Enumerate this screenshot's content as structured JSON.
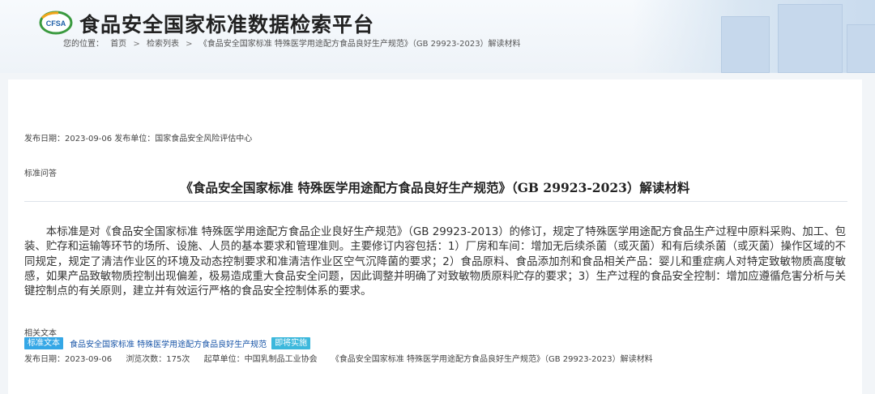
{
  "site": {
    "logo_text": "CFSA",
    "title": "食品安全国家标准数据检索平台"
  },
  "breadcrumb": {
    "prefix": "您的位置：",
    "home": "首页",
    "sep": ">",
    "list": "检索列表",
    "current": "《食品安全国家标准 特殊医学用途配方食品良好生产规范》（GB 29923-2023）解读材料"
  },
  "article": {
    "publish_meta": "发布日期：2023-09-06 发布单位：国家食品安全风险评估中心",
    "category": "标准问答",
    "title": "《食品安全国家标准 特殊医学用途配方食品良好生产规范》（GB 29923-2023）解读材料",
    "body": "本标准是对《食品安全国家标准 特殊医学用途配方食品企业良好生产规范》（GB 29923-2013）的修订，规定了特殊医学用途配方食品生产过程中原料采购、加工、包装、贮存和运输等环节的场所、设施、人员的基本要求和管理准则。主要修订内容包括：1）厂房和车间：增加无后续杀菌（或灭菌）和有后续杀菌（或灭菌）操作区域的不同规定，规定了清洁作业区的环境及动态控制要求和准清洁作业区空气沉降菌的要求；2）食品原料、食品添加剂和食品相关产品：婴儿和重症病人对特定致敏物质高度敏感，如果产品致敏物质控制出现偏差，极易造成重大食品安全问题，因此调整并明确了对致敏物质原料贮存的要求；3）生产过程的食品安全控制：增加应遵循危害分析与关键控制点的有关原则，建立并有效运行严格的食品安全控制体系的要求。"
  },
  "related": {
    "label": "相关文本",
    "tag_label": "标准文本",
    "std_name": "食品安全国家标准 特殊医学用途配方食品良好生产规范",
    "status": "即将实施",
    "publish_date": "发布日期：2023-09-06",
    "views": "浏览次数：175次",
    "drafter": "起草单位：中国乳制品工业协会",
    "doc_link": "《食品安全国家标准 特殊医学用途配方食品良好生产规范》（GB 29923-2023）解读材料"
  },
  "colors": {
    "tag_blue": "#35a7e6",
    "link_blue": "#1a56a8",
    "logo_green": "#3a9a3f"
  }
}
